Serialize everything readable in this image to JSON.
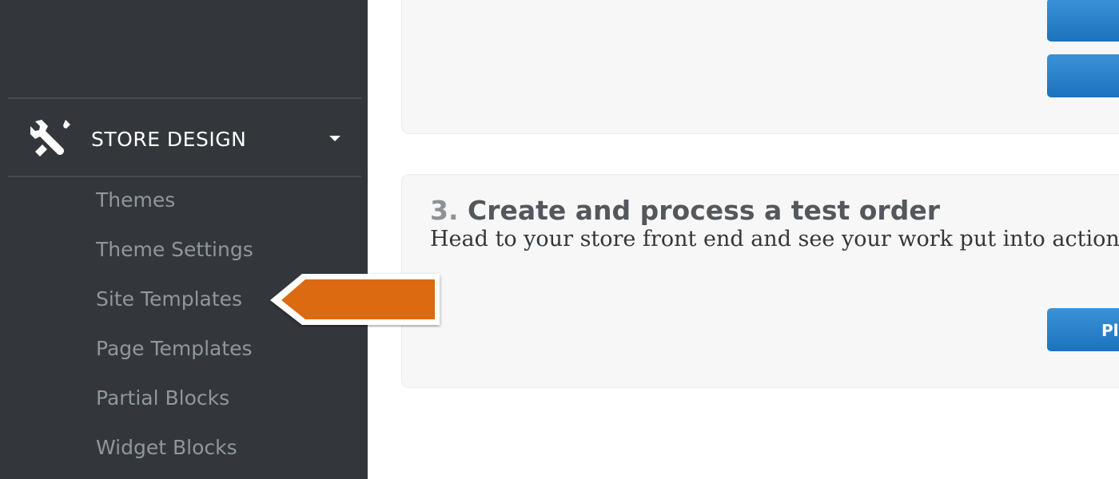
{
  "sidebar": {
    "section": {
      "title": "STORE DESIGN",
      "icon": "tools-icon",
      "toggle_icon": "caret-down-icon"
    },
    "items": [
      {
        "label": "Themes"
      },
      {
        "label": "Theme Settings"
      },
      {
        "label": "Site Templates"
      },
      {
        "label": "Page Templates"
      },
      {
        "label": "Partial Blocks"
      },
      {
        "label": "Widget Blocks"
      }
    ]
  },
  "main": {
    "step3": {
      "number": "3.",
      "title": "Create and process a test order",
      "description": "Head to your store front end and see your work put into action by p",
      "button_label": "Pl"
    }
  },
  "colors": {
    "sidebar_bg": "#33373b",
    "accent_blue": "#2a86cf",
    "callout_orange": "#dc6a10"
  }
}
